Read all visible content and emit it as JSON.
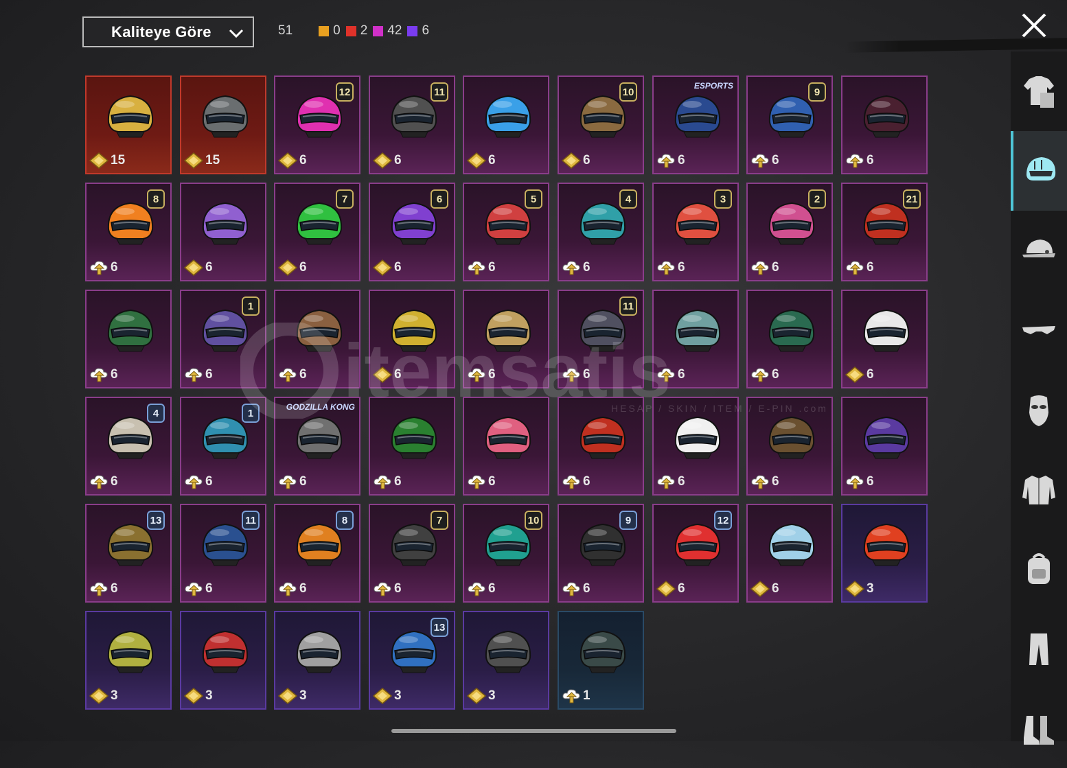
{
  "header": {
    "sort_label": "Kaliteye Göre",
    "total_count": "51",
    "quality_counts": [
      {
        "color": "#e8a020",
        "value": "0"
      },
      {
        "color": "#e0322a",
        "value": "2"
      },
      {
        "color": "#d030c8",
        "value": "42"
      },
      {
        "color": "#7a3cf0",
        "value": "6"
      }
    ]
  },
  "icons": {
    "close": "close-icon",
    "sort_chevron": "chevron-down-icon",
    "currency_gold": "gold-coin-icon",
    "currency_upgrade": "upgrade-cloud-icon"
  },
  "sidebar": {
    "items": [
      {
        "name": "outfit",
        "icon": "outfit-icon",
        "active": false
      },
      {
        "name": "helmet",
        "icon": "helmet-icon",
        "active": true
      },
      {
        "name": "hat",
        "icon": "cap-icon",
        "active": false
      },
      {
        "name": "glasses",
        "icon": "glasses-icon",
        "active": false
      },
      {
        "name": "mask",
        "icon": "mask-icon",
        "active": false
      },
      {
        "name": "jacket",
        "icon": "jacket-icon",
        "active": false
      },
      {
        "name": "backpack",
        "icon": "backpack-icon",
        "active": false
      },
      {
        "name": "pants",
        "icon": "pants-icon",
        "active": false
      },
      {
        "name": "shoes",
        "icon": "shoes-icon",
        "active": false
      }
    ]
  },
  "watermark": {
    "brand": "itemsatis",
    "sub": "HESAP / SKIN / ITEM / E-PIN",
    "tld": ".com"
  },
  "items": [
    {
      "quality": "red",
      "hue": "#d8b040",
      "currency": "gold",
      "value": "15",
      "badge": ""
    },
    {
      "quality": "red",
      "hue": "#6a6e70",
      "currency": "gold",
      "value": "15",
      "badge": ""
    },
    {
      "quality": "pink",
      "hue": "#e030b0",
      "currency": "gold",
      "value": "6",
      "badge": "12",
      "badge_style": "gold"
    },
    {
      "quality": "pink",
      "hue": "#505050",
      "currency": "gold",
      "value": "6",
      "badge": "11",
      "badge_style": "gold"
    },
    {
      "quality": "pink",
      "hue": "#3aa0e8",
      "currency": "gold",
      "value": "6",
      "badge": ""
    },
    {
      "quality": "pink",
      "hue": "#8a6a40",
      "currency": "gold",
      "value": "6",
      "badge": "10",
      "badge_style": "gold"
    },
    {
      "quality": "pink",
      "hue": "#2a4a90",
      "currency": "upgrade",
      "value": "6",
      "badge": "ESPORTS",
      "badge_style": "tag"
    },
    {
      "quality": "pink",
      "hue": "#3060b0",
      "currency": "upgrade",
      "value": "6",
      "badge": "9",
      "badge_style": "gold"
    },
    {
      "quality": "pink",
      "hue": "#4a2030",
      "currency": "upgrade",
      "value": "6",
      "badge": ""
    },
    {
      "quality": "pink",
      "hue": "#f08020",
      "currency": "upgrade",
      "value": "6",
      "badge": "8",
      "badge_style": "gold"
    },
    {
      "quality": "pink",
      "hue": "#9060d0",
      "currency": "gold",
      "value": "6",
      "badge": ""
    },
    {
      "quality": "pink",
      "hue": "#30c040",
      "currency": "gold",
      "value": "6",
      "badge": "7",
      "badge_style": "gold"
    },
    {
      "quality": "pink",
      "hue": "#8040d0",
      "currency": "gold",
      "value": "6",
      "badge": "6",
      "badge_style": "gold"
    },
    {
      "quality": "pink",
      "hue": "#d04040",
      "currency": "upgrade",
      "value": "6",
      "badge": "5",
      "badge_style": "gold"
    },
    {
      "quality": "pink",
      "hue": "#30a0a8",
      "currency": "upgrade",
      "value": "6",
      "badge": "4",
      "badge_style": "gold"
    },
    {
      "quality": "pink",
      "hue": "#e05040",
      "currency": "upgrade",
      "value": "6",
      "badge": "3",
      "badge_style": "gold"
    },
    {
      "quality": "pink",
      "hue": "#d05090",
      "currency": "upgrade",
      "value": "6",
      "badge": "2",
      "badge_style": "gold"
    },
    {
      "quality": "pink",
      "hue": "#c03020",
      "currency": "upgrade",
      "value": "6",
      "badge": "21",
      "badge_style": "gold"
    },
    {
      "quality": "pink",
      "hue": "#307040",
      "currency": "upgrade",
      "value": "6",
      "badge": ""
    },
    {
      "quality": "pink",
      "hue": "#6050a0",
      "currency": "upgrade",
      "value": "6",
      "badge": "1",
      "badge_style": "gold"
    },
    {
      "quality": "pink",
      "hue": "#8a6040",
      "currency": "upgrade",
      "value": "6",
      "badge": ""
    },
    {
      "quality": "pink",
      "hue": "#d0b030",
      "currency": "gold",
      "value": "6",
      "badge": ""
    },
    {
      "quality": "pink",
      "hue": "#c0a060",
      "currency": "upgrade",
      "value": "6",
      "badge": ""
    },
    {
      "quality": "pink",
      "hue": "#505060",
      "currency": "upgrade",
      "value": "6",
      "badge": "11",
      "badge_style": "gold"
    },
    {
      "quality": "pink",
      "hue": "#70a0a0",
      "currency": "upgrade",
      "value": "6",
      "badge": ""
    },
    {
      "quality": "pink",
      "hue": "#2a6a50",
      "currency": "upgrade",
      "value": "6",
      "badge": ""
    },
    {
      "quality": "pink",
      "hue": "#e8e8e8",
      "currency": "gold",
      "value": "6",
      "badge": ""
    },
    {
      "quality": "pink",
      "hue": "#c8c0b0",
      "currency": "upgrade",
      "value": "6",
      "badge": "4",
      "badge_style": "blue"
    },
    {
      "quality": "pink",
      "hue": "#3090b0",
      "currency": "upgrade",
      "value": "6",
      "badge": "1",
      "badge_style": "blue"
    },
    {
      "quality": "pink",
      "hue": "#707070",
      "currency": "upgrade",
      "value": "6",
      "badge": "GODZILLA KONG",
      "badge_style": "tag"
    },
    {
      "quality": "pink",
      "hue": "#2a8030",
      "currency": "upgrade",
      "value": "6",
      "badge": ""
    },
    {
      "quality": "pink",
      "hue": "#e06080",
      "currency": "upgrade",
      "value": "6",
      "badge": ""
    },
    {
      "quality": "pink",
      "hue": "#c03020",
      "currency": "upgrade",
      "value": "6",
      "badge": ""
    },
    {
      "quality": "pink",
      "hue": "#f0f0f0",
      "currency": "upgrade",
      "value": "6",
      "badge": ""
    },
    {
      "quality": "pink",
      "hue": "#6a5030",
      "currency": "upgrade",
      "value": "6",
      "badge": ""
    },
    {
      "quality": "pink",
      "hue": "#5a3aa0",
      "currency": "upgrade",
      "value": "6",
      "badge": ""
    },
    {
      "quality": "pink",
      "hue": "#8a7030",
      "currency": "upgrade",
      "value": "6",
      "badge": "13",
      "badge_style": "blue"
    },
    {
      "quality": "pink",
      "hue": "#2a5090",
      "currency": "upgrade",
      "value": "6",
      "badge": "11",
      "badge_style": "blue"
    },
    {
      "quality": "pink",
      "hue": "#e08020",
      "currency": "upgrade",
      "value": "6",
      "badge": "8",
      "badge_style": "blue"
    },
    {
      "quality": "pink",
      "hue": "#404040",
      "currency": "upgrade",
      "value": "6",
      "badge": "7",
      "badge_style": "gold"
    },
    {
      "quality": "pink",
      "hue": "#20a090",
      "currency": "upgrade",
      "value": "6",
      "badge": "10",
      "badge_style": "gold"
    },
    {
      "quality": "pink",
      "hue": "#303030",
      "currency": "upgrade",
      "value": "6",
      "badge": "9",
      "badge_style": "blue"
    },
    {
      "quality": "pink",
      "hue": "#e03030",
      "currency": "gold",
      "value": "6",
      "badge": "12",
      "badge_style": "blue"
    },
    {
      "quality": "pink",
      "hue": "#a0d0e8",
      "currency": "gold",
      "value": "6",
      "badge": ""
    },
    {
      "quality": "purple",
      "hue": "#e04020",
      "currency": "gold",
      "value": "3",
      "badge": ""
    },
    {
      "quality": "purple",
      "hue": "#b0b040",
      "currency": "gold",
      "value": "3",
      "badge": ""
    },
    {
      "quality": "purple",
      "hue": "#c03030",
      "currency": "gold",
      "value": "3",
      "badge": ""
    },
    {
      "quality": "purple",
      "hue": "#a0a0a0",
      "currency": "gold",
      "value": "3",
      "badge": ""
    },
    {
      "quality": "purple",
      "hue": "#3070c0",
      "currency": "gold",
      "value": "3",
      "badge": "13",
      "badge_style": "blue"
    },
    {
      "quality": "purple",
      "hue": "#505050",
      "currency": "gold",
      "value": "3",
      "badge": ""
    },
    {
      "quality": "blue",
      "hue": "#3a4a48",
      "currency": "upgrade",
      "value": "1",
      "badge": ""
    }
  ]
}
